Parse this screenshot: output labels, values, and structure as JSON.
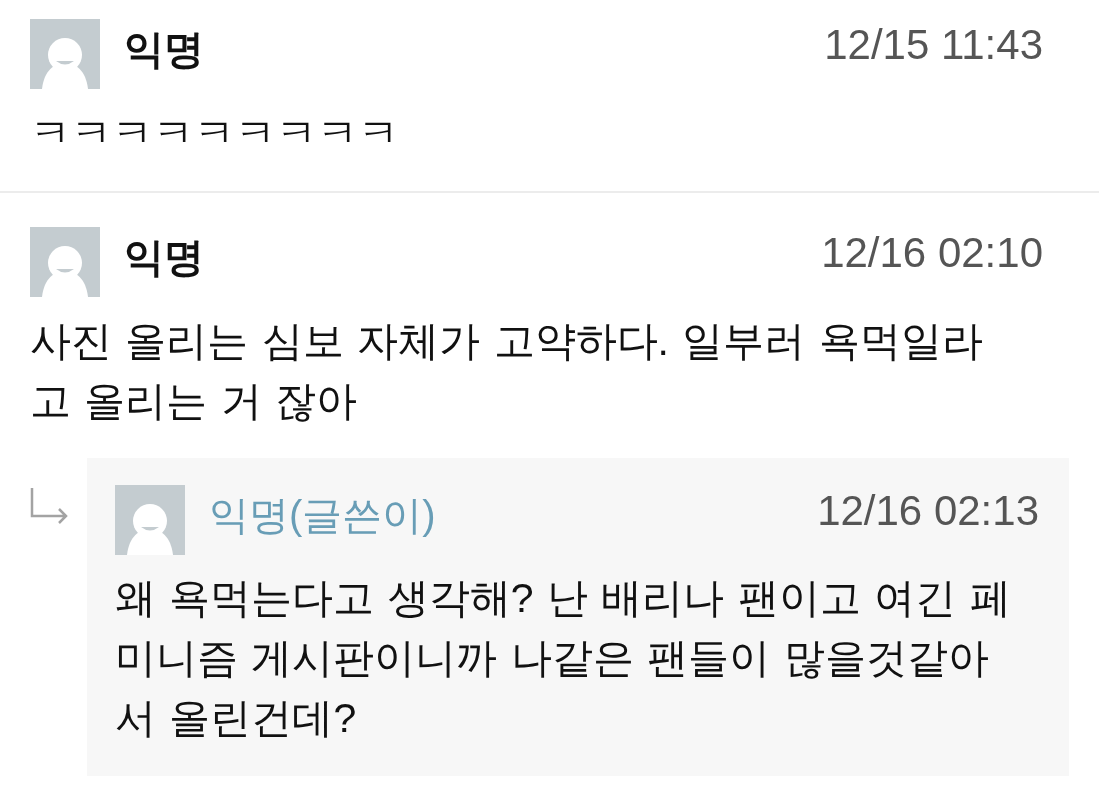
{
  "comments": [
    {
      "author": "익명",
      "is_writer": false,
      "time": "12/15 11:43",
      "text": "ㅋㅋㅋㅋㅋㅋㅋㅋㅋ"
    },
    {
      "author": "익명",
      "is_writer": false,
      "time": "12/16 02:10",
      "text": "사진 올리는 심보 자체가 고약하다. 일부러 욕먹일라고 올리는 거 잖아",
      "replies": [
        {
          "author": "익명(글쓴이)",
          "is_writer": true,
          "time": "12/16 02:13",
          "text": "왜 욕먹는다고 생각해? 난 배리나 팬이고 여긴 페미니즘 게시판이니까 나같은 팬들이 많을것같아서 올린건데?"
        }
      ]
    }
  ]
}
